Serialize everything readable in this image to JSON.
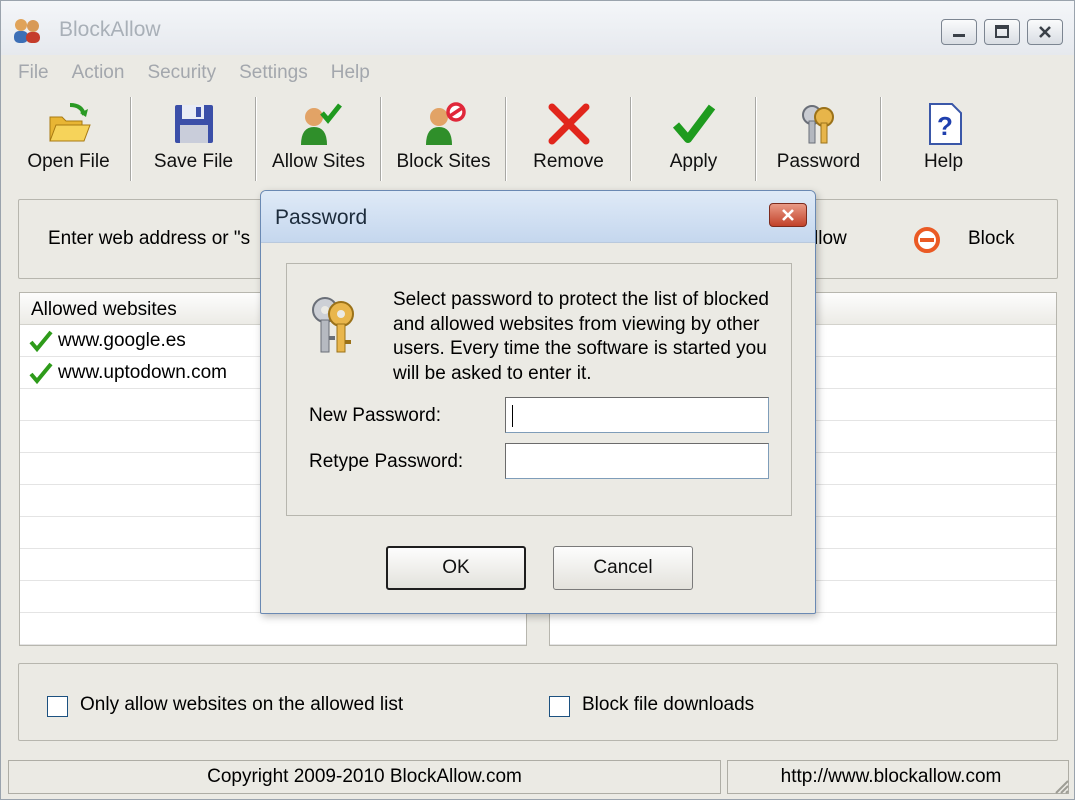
{
  "app": {
    "title": "BlockAllow"
  },
  "menu": [
    "File",
    "Action",
    "Security",
    "Settings",
    "Help"
  ],
  "toolbar": [
    {
      "label": "Open File",
      "icon": "folder-open-icon"
    },
    {
      "label": "Save File",
      "icon": "floppy-disk-icon"
    },
    {
      "label": "Allow Sites",
      "icon": "user-check-icon"
    },
    {
      "label": "Block Sites",
      "icon": "user-block-icon"
    },
    {
      "label": "Remove",
      "icon": "red-x-icon"
    },
    {
      "label": "Apply",
      "icon": "green-check-icon"
    },
    {
      "label": "Password",
      "icon": "keys-icon"
    },
    {
      "label": "Help",
      "icon": "help-document-icon"
    }
  ],
  "address": {
    "label": "Enter web address or \"s",
    "allow_label": "llow",
    "block_label": "Block"
  },
  "lists": {
    "allowed_header": "Allowed websites",
    "allowed_items": [
      "www.google.es",
      "www.uptodown.com"
    ],
    "blocked_header": ""
  },
  "options": {
    "only_allowed_label": "Only allow websites on the allowed list",
    "only_allowed_checked": false,
    "block_downloads_label": "Block file downloads",
    "block_downloads_checked": false
  },
  "status": {
    "copyright": "Copyright 2009-2010 BlockAllow.com",
    "url": "http://www.blockallow.com"
  },
  "dialog": {
    "title": "Password",
    "description": "Select password to protect the list of blocked and allowed websites from viewing by other users. Every time the software is started you will be asked to enter it.",
    "new_password_label": "New Password:",
    "new_password_value": "",
    "retype_password_label": "Retype Password:",
    "retype_password_value": "",
    "ok_label": "OK",
    "cancel_label": "Cancel"
  },
  "colors": {
    "accent_check": "#2e9b1a",
    "block_red": "#e8451b",
    "dialog_title": "#c9daf0"
  }
}
